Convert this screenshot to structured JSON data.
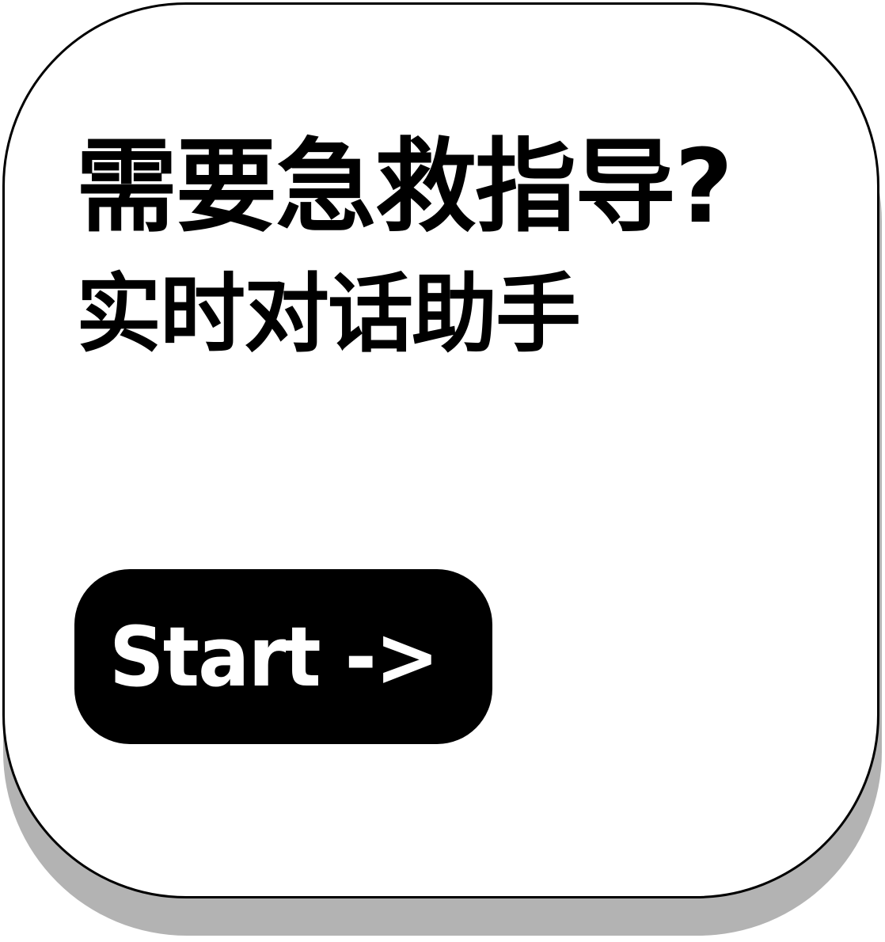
{
  "card": {
    "title_line_1": "需要急救指导?",
    "title_line_2": "实时对话助手",
    "start_button_label": "Start ->"
  },
  "colors": {
    "background": "#ffffff",
    "card_border": "#000000",
    "card_shadow": "#b3b3b3",
    "button_background": "#000000",
    "button_text": "#ffffff"
  }
}
